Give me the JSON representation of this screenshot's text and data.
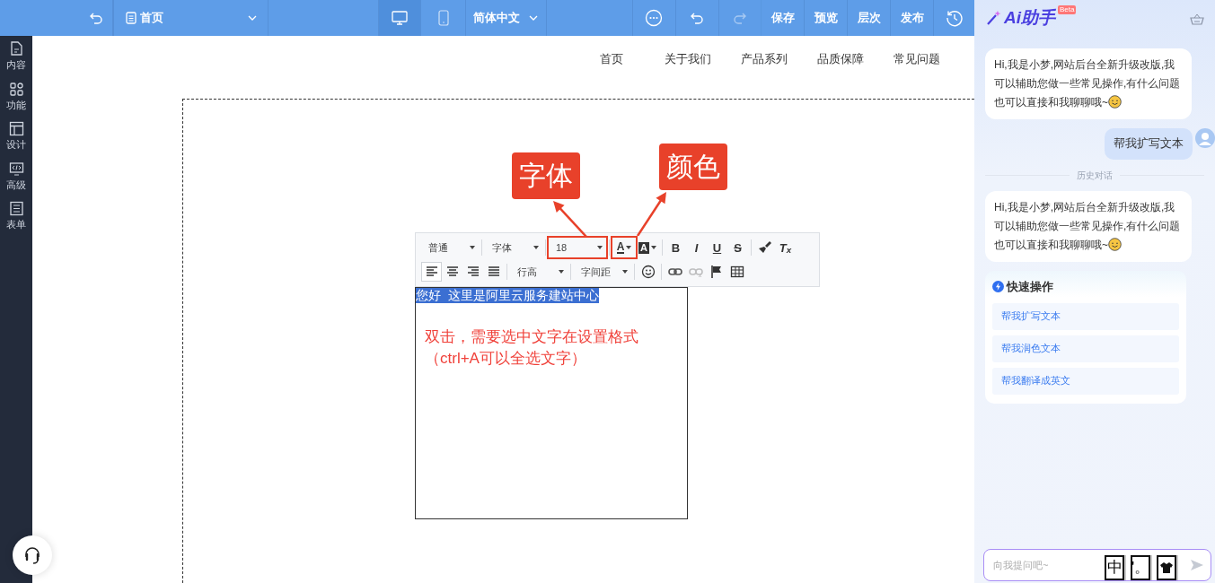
{
  "top_bar": {
    "page_select": "首页",
    "devices": [
      {
        "kind": "desktop",
        "selected": true
      },
      {
        "kind": "mobile",
        "selected": false
      }
    ],
    "language": "简体中文",
    "undo_disabled": false,
    "redo_disabled": true,
    "actions": [
      "保存",
      "预览",
      "层次",
      "发布"
    ]
  },
  "sidebar": {
    "items": [
      {
        "label": "内容"
      },
      {
        "label": "功能"
      },
      {
        "label": "设计"
      },
      {
        "label": "高级"
      },
      {
        "label": "表单"
      }
    ]
  },
  "site_nav": [
    "首页",
    "关于我们",
    "产品系列",
    "品质保障",
    "常见问题"
  ],
  "toolbar": {
    "rows": [
      [
        {
          "kind": "select",
          "label": "普通",
          "highlighted": false
        },
        {
          "kind": "separator"
        },
        {
          "kind": "select",
          "label": "字体",
          "highlighted": false
        },
        {
          "kind": "separator"
        },
        {
          "kind": "select",
          "label": "18",
          "highlighted": true
        },
        {
          "kind": "separator"
        },
        {
          "kind": "font-color",
          "label": "A",
          "highlighted": true
        },
        {
          "kind": "highlight-color",
          "label": "A",
          "highlighted": false
        },
        {
          "kind": "separator"
        },
        {
          "kind": "bold",
          "label": "B",
          "highlighted": false
        },
        {
          "kind": "italic",
          "label": "I",
          "highlighted": false
        },
        {
          "kind": "underline",
          "label": "U",
          "highlighted": false
        },
        {
          "kind": "strike",
          "label": "S",
          "highlighted": false
        },
        {
          "kind": "separator"
        },
        {
          "kind": "brush",
          "highlighted": false
        },
        {
          "kind": "clear-format",
          "label": "T$_{x}$",
          "highlighted": false
        }
      ],
      [
        {
          "kind": "align-left",
          "selected": true
        },
        {
          "kind": "align-center",
          "selected": false
        },
        {
          "kind": "align-right",
          "selected": false
        },
        {
          "kind": "justify",
          "selected": false
        },
        {
          "kind": "separator"
        },
        {
          "kind": "select",
          "label": "行高"
        },
        {
          "kind": "separator"
        },
        {
          "kind": "select",
          "label": "字间距"
        },
        {
          "kind": "separator"
        },
        {
          "kind": "emoji"
        },
        {
          "kind": "separator"
        },
        {
          "kind": "link",
          "disabled": false
        },
        {
          "kind": "unlink",
          "disabled": true
        },
        {
          "kind": "flag"
        },
        {
          "kind": "table"
        }
      ]
    ]
  },
  "text_box": {
    "selected_text": "您好  这里是阿里云服务建站中心",
    "instructions": [
      "双击，需要选中文字在设置格式",
      "（ctrl+A可以全选文字）"
    ]
  },
  "annotations": [
    {
      "text": "字体"
    },
    {
      "text": "颜色"
    }
  ],
  "assistant": {
    "title": "Ai助手",
    "badge": "Beta",
    "messages": [
      {
        "kind": "bot",
        "text": "Hi,我是小梦,网站后台全新升级改版,我可以辅助您做一些常见操作,有什么问题也可以直接和我聊聊哦~"
      },
      {
        "kind": "user",
        "text": "帮我扩写文本"
      },
      {
        "kind": "divider",
        "text": "历史对话"
      },
      {
        "kind": "bot",
        "text": "Hi,我是小梦,网站后台全新升级改版,我可以辅助您做一些常见操作,有什么问题也可以直接和我聊聊哦~"
      }
    ],
    "quick_actions": {
      "title": "快速操作",
      "items": [
        "帮我扩写文本",
        "帮我润色文本",
        "帮我翻译成英文"
      ]
    },
    "input": {
      "placeholder": "向我提问吧~"
    },
    "ime_bar": [
      "中",
      "'。"
    ]
  }
}
